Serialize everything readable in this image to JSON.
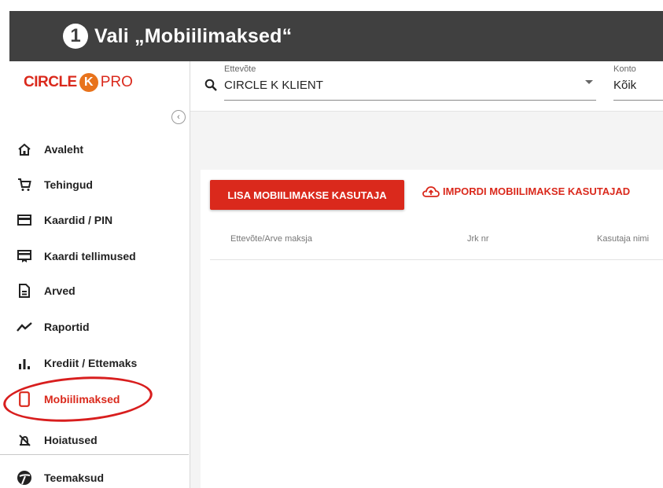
{
  "banner": {
    "number": "1",
    "text": "Vali „Mobiilimaksed“"
  },
  "logo": {
    "circle": "CIRCLE",
    "k": "K",
    "pro": "PRO"
  },
  "sidebar": {
    "collapse_glyph": "‹",
    "items": [
      {
        "label": "Avaleht",
        "icon": "home-icon"
      },
      {
        "label": "Tehingud",
        "icon": "cart-icon"
      },
      {
        "label": "Kaardid / PIN",
        "icon": "card-icon"
      },
      {
        "label": "Kaardi tellimused",
        "icon": "card-order-icon"
      },
      {
        "label": "Arved",
        "icon": "invoice-icon"
      },
      {
        "label": "Raportid",
        "icon": "trend-icon"
      },
      {
        "label": "Krediit / Ettemaks",
        "icon": "bar-chart-icon"
      },
      {
        "label": "Mobiilimaksed",
        "icon": "phone-icon",
        "active": true
      },
      {
        "label": "Hoiatused",
        "icon": "alarm-icon"
      },
      {
        "label": "Teemaksud",
        "icon": "road-icon"
      }
    ]
  },
  "filters": {
    "company": {
      "label": "Ettevõte",
      "value": "CIRCLE K KLIENT"
    },
    "account": {
      "label": "Konto",
      "value": "Kõik"
    }
  },
  "actions": {
    "add": "LISA MOBIILIMAKSE KASUTAJA",
    "import": "IMPORDI MOBIILIMAKSE KASUTAJAD"
  },
  "table": {
    "columns": [
      "Ettevõte/Arve maksja",
      "Jrk nr",
      "Kasutaja nimi"
    ]
  },
  "colors": {
    "accent": "#da291c",
    "banner": "#404040",
    "highlight": "#d81e1e"
  }
}
